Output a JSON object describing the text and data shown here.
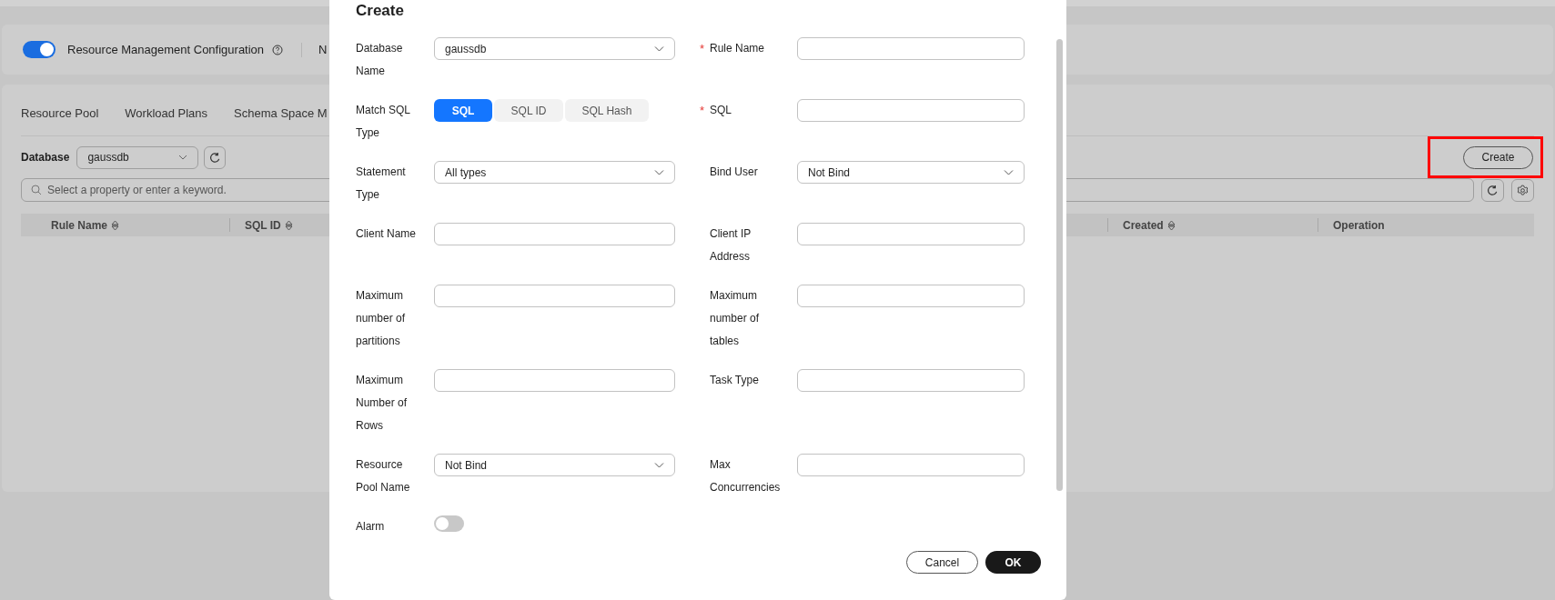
{
  "config_bar": {
    "toggle_on": true,
    "label": "Resource Management Configuration",
    "next_label": "N"
  },
  "tabs": [
    {
      "label": "Resource Pool",
      "selected": false
    },
    {
      "label": "Workload Plans",
      "selected": false
    },
    {
      "label": "Schema Space M",
      "selected": false
    }
  ],
  "database_filter": {
    "label": "Database",
    "value": "gaussdb"
  },
  "create_button": "Create",
  "search": {
    "placeholder": "Select a property or enter a keyword."
  },
  "table": {
    "columns": [
      {
        "label": "Rule Name",
        "sortable": true
      },
      {
        "label": "SQL ID",
        "sortable": true
      },
      {
        "label": "Created",
        "sortable": true
      },
      {
        "label": "Operation",
        "sortable": false
      }
    ]
  },
  "dialog": {
    "title": "Create",
    "rows": [
      {
        "left": {
          "kind": "select",
          "label": "Database Name",
          "value": "gaussdb"
        },
        "right": {
          "kind": "input",
          "label": "Rule Name",
          "required_mark": "*"
        }
      },
      {
        "left": {
          "kind": "segmented",
          "label": "Match SQL Type",
          "options": [
            {
              "label": "SQL",
              "selected": true
            },
            {
              "label": "SQL ID",
              "selected": false
            },
            {
              "label": "SQL Hash",
              "selected": false
            }
          ]
        },
        "right": {
          "kind": "input",
          "label": "SQL",
          "required_mark": "*"
        }
      },
      {
        "left": {
          "kind": "select",
          "label": "Statement Type",
          "value": "All types"
        },
        "right": {
          "kind": "select",
          "label": "Bind User",
          "value": "Not Bind"
        }
      },
      {
        "left": {
          "kind": "input",
          "label": "Client Name"
        },
        "right": {
          "kind": "input",
          "label": "Client IP Address"
        }
      },
      {
        "left": {
          "kind": "input",
          "label": "Maximum number of partitions"
        },
        "right": {
          "kind": "input",
          "label": "Maximum number of tables"
        }
      },
      {
        "left": {
          "kind": "input",
          "label": "Maximum Number of Rows"
        },
        "right": {
          "kind": "input",
          "label": "Task Type"
        }
      },
      {
        "left": {
          "kind": "select",
          "label": "Resource Pool Name",
          "value": "Not Bind"
        },
        "right": {
          "kind": "input",
          "label": "Max Concurrencies"
        }
      },
      {
        "left": {
          "kind": "toggle",
          "label": "Alarm",
          "on": false
        }
      }
    ],
    "buttons": [
      {
        "label": "Cancel",
        "primary": false
      },
      {
        "label": "OK",
        "primary": true
      }
    ]
  }
}
